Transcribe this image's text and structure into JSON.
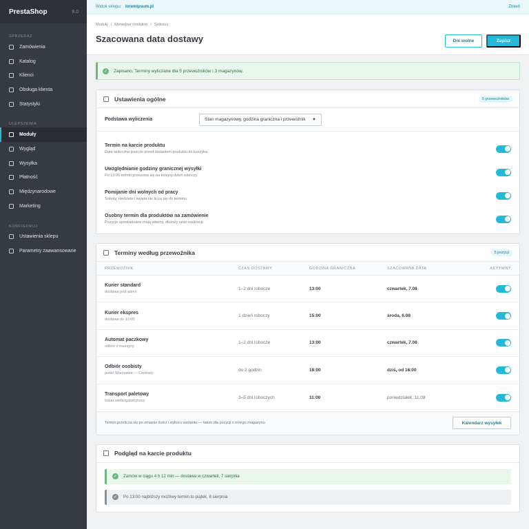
{
  "brand": {
    "name": "PrestaShop",
    "version": "9.0"
  },
  "sidebar": {
    "sections": [
      {
        "label": "SPRZEDAŻ",
        "items": [
          "Zamówienia",
          "Katalog",
          "Klienci",
          "Obsługa klienta",
          "Statystyki"
        ]
      },
      {
        "label": "ULEPSZENIA",
        "items": [
          "Moduły",
          "Wygląd",
          "Wysyłka",
          "Płatność",
          "Międzynarodowe",
          "Marketing"
        ]
      },
      {
        "label": "KONFIGURUJ",
        "items": [
          "Ustawienia sklepu",
          "Parametry zaawansowane"
        ]
      }
    ],
    "active_item": "Moduły"
  },
  "topbar": {
    "label": "Widok sklepu:",
    "shop": "loremipsum.pl",
    "change": "Zmień"
  },
  "header": {
    "breadcrumb": [
      "Moduły",
      "Menedżer modułów",
      "Sellision"
    ],
    "title": "Szacowana data dostawy",
    "btn_holidays": "Dni wolne",
    "btn_save": "Zapisz"
  },
  "alert": {
    "text": "Zapisano. Terminy wyliczane dla 5 przewoźników i 3 magazynów."
  },
  "general": {
    "title": "Ustawienia ogólne",
    "badge": "5 przewoźników",
    "basis_label": "Podstawa wyliczenia",
    "basis_value": "Stan magazynowy, godzina graniczna i przewoźnik",
    "settings": [
      {
        "title": "Termin na karcie produktu",
        "desc": "Data widoczna jeszcze przed dodaniem produktu do koszyka.",
        "on": true
      },
      {
        "title": "Uwzględnianie godziny granicznej wysyłki",
        "desc": "Po 13:00 termin przesuwa się na kolejny dzień roboczy.",
        "on": true
      },
      {
        "title": "Pomijanie dni wolnych od pracy",
        "desc": "Soboty, niedziele i święta nie liczą się do terminu.",
        "on": true
      },
      {
        "title": "Osobny termin dla produktów na zamówienie",
        "desc": "Pozycje sprowadzane mają własny, dłuższy czas realizacji.",
        "on": true
      }
    ]
  },
  "carriers": {
    "title": "Terminy według przewoźnika",
    "badge": "5 pozycji",
    "columns": [
      "PRZEWOŹNIK",
      "CZAS DOSTAWY",
      "GODZINA GRANICZNA",
      "SZACOWANA DATA",
      "AKTYWNY"
    ],
    "rows": [
      {
        "name": "Kurier standard",
        "sub": "dostawa pod adres",
        "time": "1–2 dni robocze",
        "cutoff": "13:00",
        "date": "czwartek, 7.08",
        "date_bold": true,
        "active": true
      },
      {
        "name": "Kurier ekspres",
        "sub": "dostawa do 12:00",
        "time": "1 dzień roboczy",
        "cutoff": "15:00",
        "date": "środa, 6.08",
        "date_bold": true,
        "active": true
      },
      {
        "name": "Automat paczkowy",
        "sub": "odbiór z maszyny",
        "time": "1–2 dni robocze",
        "cutoff": "13:00",
        "date": "czwartek, 7.08",
        "date_bold": true,
        "active": true
      },
      {
        "name": "Odbiór osobisty",
        "sub": "punkt Warszawa — Centrum",
        "time": "do 2 godzin",
        "cutoff": "18:00",
        "date": "dziś, od 16:00",
        "date_bold": true,
        "active": true
      },
      {
        "name": "Transport paletowy",
        "sub": "towar wielkogabarytowy",
        "time": "3–5 dni roboczych",
        "cutoff": "11:00",
        "date": "poniedziałek, 11.08",
        "date_bold": false,
        "active": true
      }
    ],
    "footer_note": "Termin przelicza się po zmianie ilości i wyboru wariantu — także dla pozycji z innego magazynu.",
    "footer_button": "Kalendarz wysyłek"
  },
  "preview": {
    "title": "Podgląd na karcie produktu",
    "line1": "Zamów w ciągu 4 h 12 min — dostawa w czwartek, 7 sierpnia",
    "line2": "Po 13:00 najbliższy możliwy termin to piątek, 8 sierpnia"
  },
  "colors": {
    "accent": "#25b9d7",
    "success": "#70b580",
    "sidebar": "#363a41"
  }
}
